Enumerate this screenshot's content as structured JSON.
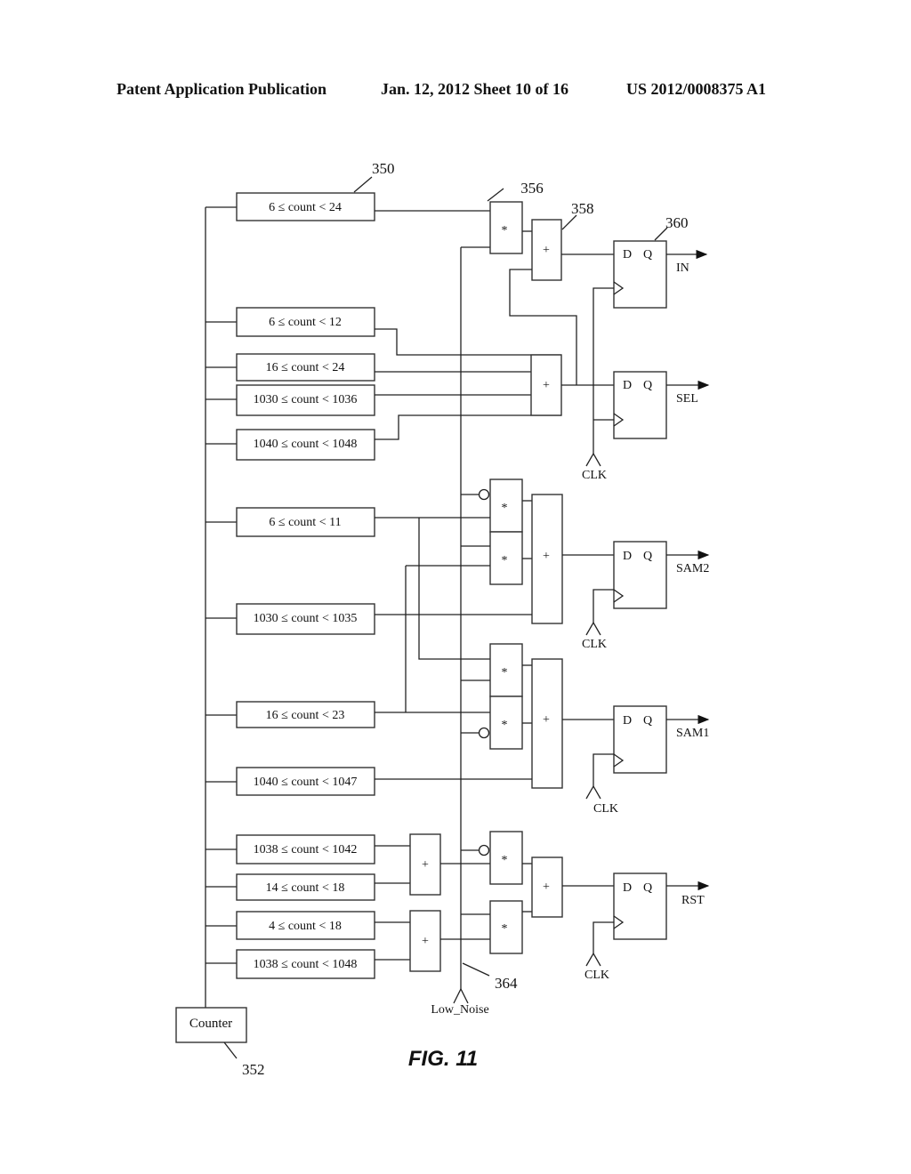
{
  "header": {
    "left": "Patent Application Publication",
    "date_sheet": "Jan. 12, 2012  Sheet 10 of 16",
    "number": "US 2012/0008375 A1"
  },
  "figure": {
    "caption": "FIG. 11",
    "counter_label": "Counter",
    "refs": {
      "comparator": "350",
      "counter": "352",
      "and_gate": "356",
      "or_gate": "358",
      "flip_flop": "360",
      "low_noise_line": "364"
    },
    "comparators": [
      "6 ≤ count < 24",
      "6 ≤ count < 12",
      "16 ≤ count < 24",
      "1030 ≤ count < 1036",
      "1040 ≤ count < 1048",
      "6 ≤ count < 11",
      "1030 ≤ count < 1035",
      "16 ≤ count < 23",
      "1040 ≤ count < 1047",
      "1038 ≤ count < 1042",
      "14 ≤ count < 18",
      "4 ≤ count < 18",
      "1038 ≤ count < 1048"
    ],
    "operators": {
      "and": "*",
      "or": "+"
    },
    "flip_flop": {
      "d": "D",
      "q": "Q"
    },
    "outputs": [
      "IN",
      "SEL",
      "SAM2",
      "SAM1",
      "RST"
    ],
    "clock_label": "CLK",
    "low_noise_label": "Low_Noise"
  }
}
